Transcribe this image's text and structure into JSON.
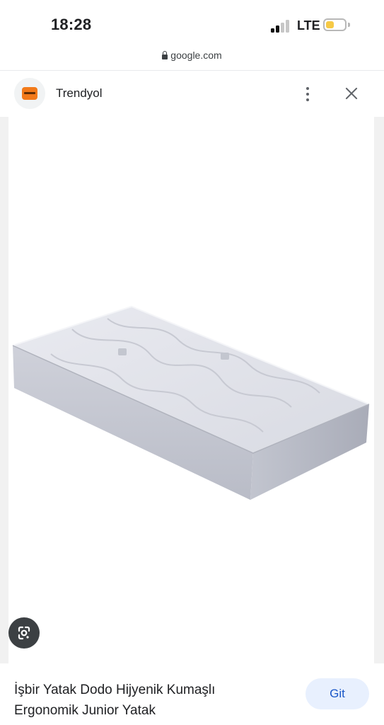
{
  "status_bar": {
    "time": "18:28",
    "network": "LTE",
    "battery_level": 0.45,
    "battery_color": "#f6c945"
  },
  "url_bar": {
    "url": "google.com",
    "icon": "lock-icon"
  },
  "header": {
    "site_name": "Trendyol",
    "logo_color": "#f27a1a",
    "icons": [
      "more-vert-icon",
      "close-icon"
    ]
  },
  "image": {
    "subject": "mattress",
    "lens_icon": "google-lens-icon"
  },
  "result": {
    "title_line1": "İşbir Yatak Dodo Hijyenik Kumaşlı",
    "title_line2": "Ergonomik Junior Yatak",
    "button_label": "Git",
    "accent_color": "#1a57c8"
  }
}
